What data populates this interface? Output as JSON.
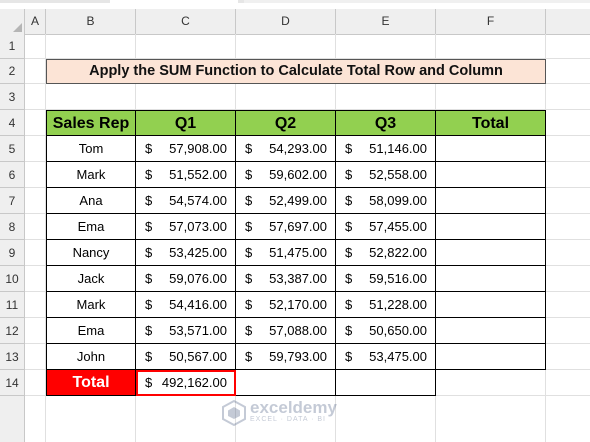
{
  "columns": [
    "A",
    "B",
    "C",
    "D",
    "E",
    "F"
  ],
  "rows": [
    "1",
    "2",
    "3",
    "4",
    "5",
    "6",
    "7",
    "8",
    "9",
    "10",
    "11",
    "12",
    "13",
    "14"
  ],
  "title": "Apply the SUM Function to Calculate Total Row and Column",
  "headers": [
    "Sales Rep",
    "Q1",
    "Q2",
    "Q3",
    "Total"
  ],
  "currency_symbol": "$",
  "data_rows": [
    {
      "rep": "Tom",
      "q1": "57,908.00",
      "q2": "54,293.00",
      "q3": "51,146.00"
    },
    {
      "rep": "Mark",
      "q1": "51,552.00",
      "q2": "59,602.00",
      "q3": "52,558.00"
    },
    {
      "rep": "Ana",
      "q1": "54,574.00",
      "q2": "52,499.00",
      "q3": "58,099.00"
    },
    {
      "rep": "Ema",
      "q1": "57,073.00",
      "q2": "57,697.00",
      "q3": "57,455.00"
    },
    {
      "rep": "Nancy",
      "q1": "53,425.00",
      "q2": "51,475.00",
      "q3": "52,822.00"
    },
    {
      "rep": "Jack",
      "q1": "59,076.00",
      "q2": "53,387.00",
      "q3": "59,516.00"
    },
    {
      "rep": "Mark",
      "q1": "54,416.00",
      "q2": "52,170.00",
      "q3": "51,228.00"
    },
    {
      "rep": "Ema",
      "q1": "53,571.00",
      "q2": "57,088.00",
      "q3": "50,650.00"
    },
    {
      "rep": "John",
      "q1": "50,567.00",
      "q2": "59,793.00",
      "q3": "53,475.00"
    }
  ],
  "total_row": {
    "label": "Total",
    "q1": "492,162.00"
  },
  "watermark": {
    "brand": "exceldemy",
    "tagline": "EXCEL · DATA · BI"
  },
  "colors": {
    "header_green": "#92d050",
    "title_fill": "#fce4d6",
    "total_red": "#ff0000",
    "selection": "#ff0000"
  }
}
